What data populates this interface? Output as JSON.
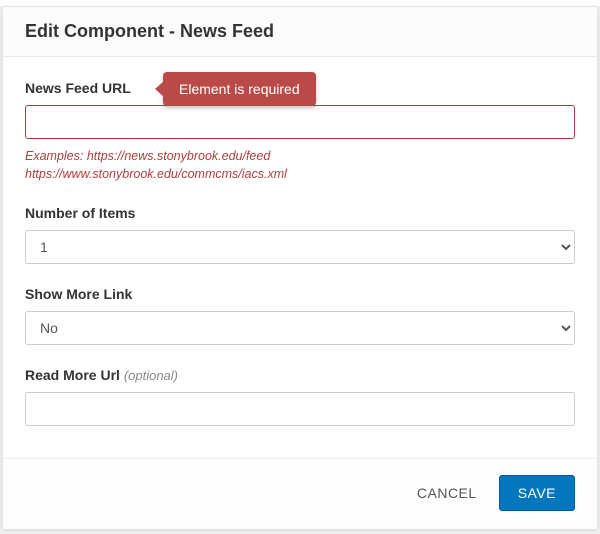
{
  "header": {
    "title": "Edit Component - News Feed"
  },
  "form": {
    "url": {
      "label": "News Feed URL",
      "value": "",
      "tooltip": "Element is required",
      "help_line1": "Examples: https://news.stonybrook.edu/feed",
      "help_line2": "https://www.stonybrook.edu/commcms/iacs.xml"
    },
    "num_items": {
      "label": "Number of Items",
      "selected": "1"
    },
    "show_more": {
      "label": "Show More Link",
      "selected": "No"
    },
    "read_more": {
      "label": "Read More Url ",
      "optional": "(optional)",
      "value": ""
    }
  },
  "footer": {
    "cancel": "CANCEL",
    "save": "SAVE"
  }
}
